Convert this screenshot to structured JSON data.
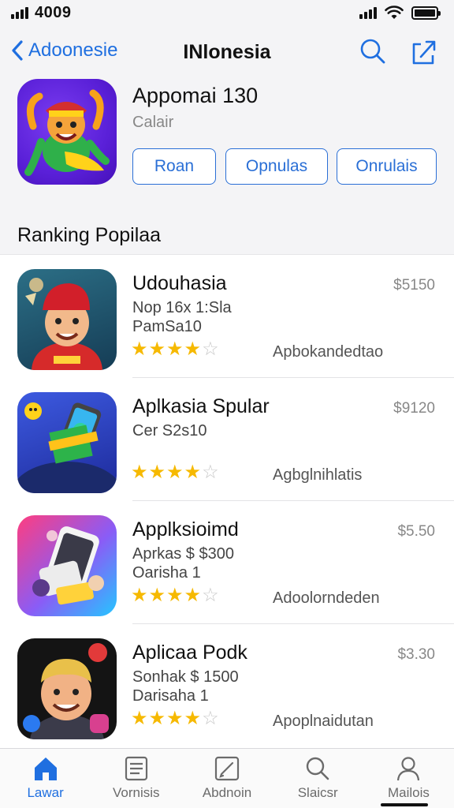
{
  "status_bar": {
    "time": "4009",
    "icons": [
      "cellular-signal-icon",
      "wifi-icon",
      "battery-icon"
    ]
  },
  "nav": {
    "back_label": "Adoonesie",
    "title": "INlonesia",
    "icons": [
      "chevron-left-icon",
      "search-icon",
      "share-icon"
    ]
  },
  "featured": {
    "title": "Appomai 130",
    "subtitle": "Calair",
    "chips": [
      "Roan",
      "Opnulas",
      "Onrulais"
    ]
  },
  "section_title": "Ranking Popilaa",
  "apps": [
    {
      "name": "Udouhasia",
      "price": "$5150",
      "meta1": "Nop 16x 1:Sla",
      "meta2": "PamSa10",
      "rating": 4,
      "tag": "Apbokandedtao"
    },
    {
      "name": "Aplkasia Spular",
      "price": "$9120",
      "meta1": "Cer S2s10",
      "meta2": "",
      "rating": 4,
      "tag": "Agbglnihlatis"
    },
    {
      "name": "Applksioimd",
      "price": "$5.50",
      "meta1": "Aprkas $ $300",
      "meta2": "Oarisha 1",
      "rating": 4,
      "tag": "Adoolorndeden"
    },
    {
      "name": "Aplicaa Podk",
      "price": "$3.30",
      "meta1": "Sonhak $ 1500",
      "meta2": "Darisaha 1",
      "rating": 4,
      "tag": "Apoplnaidutan"
    }
  ],
  "tabs": [
    {
      "label": "Lawar",
      "icon": "home-icon",
      "active": true
    },
    {
      "label": "Vornisis",
      "icon": "list-icon",
      "active": false
    },
    {
      "label": "Abdnoin",
      "icon": "compose-icon",
      "active": false
    },
    {
      "label": "Slaicsr",
      "icon": "search-icon",
      "active": false
    },
    {
      "label": "Mailois",
      "icon": "profile-icon",
      "active": false
    }
  ],
  "colors": {
    "accent": "#1f6fe0",
    "star": "#f6b900",
    "background": "#f4f4f6"
  }
}
